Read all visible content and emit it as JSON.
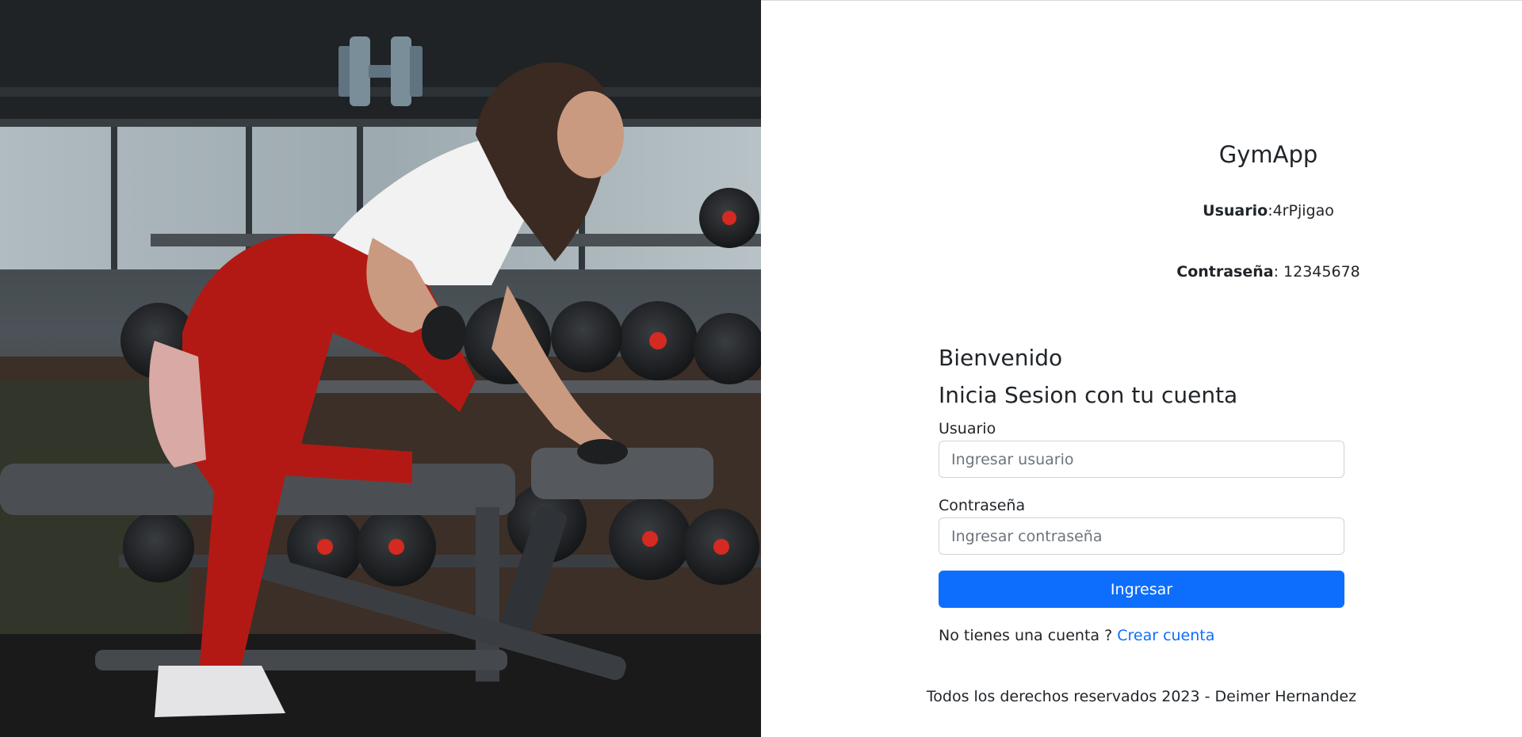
{
  "brand": {
    "name": "GymApp",
    "logo_icon": "dumbbell-icon"
  },
  "credentials_hint": {
    "user_label": "Usuario",
    "user_value": ":4rPjigao",
    "pass_label": "Contraseña",
    "pass_value": ": 12345678"
  },
  "form": {
    "welcome": "Bienvenido",
    "subtitle": "Inicia Sesion con tu cuenta",
    "username_label": "Usuario",
    "username_placeholder": "Ingresar usuario",
    "password_label": "Contraseña",
    "password_placeholder": "Ingresar contraseña",
    "submit_label": "Ingresar",
    "signup_prompt": "No tienes una cuenta ? ",
    "signup_link": "Crear cuenta"
  },
  "footer": {
    "text": "Todos los derechos reservados 2023 - Deimer Hernandez"
  },
  "colors": {
    "primary": "#0d6efd",
    "logo": "#5f7380",
    "text": "#212529"
  }
}
